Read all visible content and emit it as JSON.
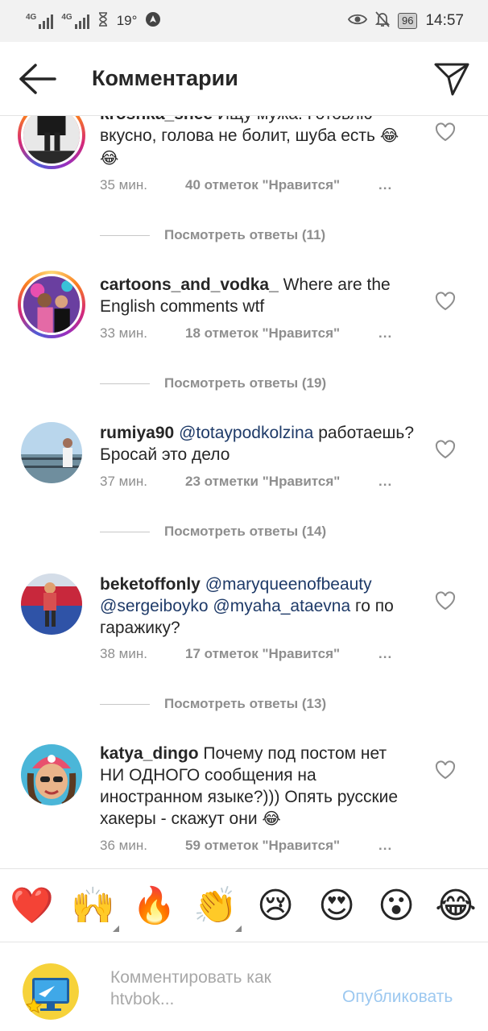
{
  "status_bar": {
    "signal1": "4G",
    "signal2": "4G",
    "temperature": "19°",
    "battery": "96",
    "time": "14:57"
  },
  "header": {
    "title": "Комментарии"
  },
  "comments": [
    {
      "username": "kroshka_shee",
      "text_parts": [
        "Ищу мужа. Готовлю вкусно, голова не болит, шуба есть"
      ],
      "emoji": "😂 😂",
      "time": "35 мин.",
      "likes": "40 отметок \"Нравится\"",
      "more": "...",
      "replies": "Посмотреть ответы (11)"
    },
    {
      "username": "cartoons_and_vodka_",
      "text": "Where are the English comments wtf",
      "time": "33 мин.",
      "likes": "18 отметок \"Нравится\"",
      "more": "...",
      "replies": "Посмотреть ответы (19)"
    },
    {
      "username": "rumiya90",
      "mention": "@totaypodkolzina",
      "text": "работаешь? Бросай это дело",
      "time": "37 мин.",
      "likes": "23 отметки \"Нравится\"",
      "more": "...",
      "replies": "Посмотреть ответы (14)"
    },
    {
      "username": "beketoffonly",
      "mention1": "@maryqueenofbeauty",
      "mention2": "@sergeiboyko",
      "mention3": "@myaha_ataevna",
      "text": "го по гаражику?",
      "time": "38 мин.",
      "likes": "17 отметок \"Нравится\"",
      "more": "...",
      "replies": "Посмотреть ответы (13)"
    },
    {
      "username": "katya_dingo",
      "text": "Почему под постом нет НИ ОДНОГО сообщения на иностранном языке?))) Опять русские хакеры - скажут они",
      "emoji": "😂",
      "time": "36 мин.",
      "likes": "59 отметок \"Нравится\"",
      "more": "..."
    }
  ],
  "reactions": [
    "❤️",
    "🙌",
    "🔥",
    "👏",
    "😢",
    "😍",
    "😮",
    "😂"
  ],
  "composer": {
    "placeholder": "Комментировать как htvbok...",
    "publish_label": "Опубликовать"
  },
  "colors": {
    "mention": "#1e3a68",
    "secondary_text": "#8e8e8e",
    "publish_disabled": "#9cc8f0",
    "heart": "#e0245e"
  },
  "icons": [
    "back-arrow-icon",
    "direct-send-icon",
    "heart-outline-icon",
    "eye-icon",
    "bell-off-icon",
    "hourglass-icon",
    "nav-icon"
  ]
}
